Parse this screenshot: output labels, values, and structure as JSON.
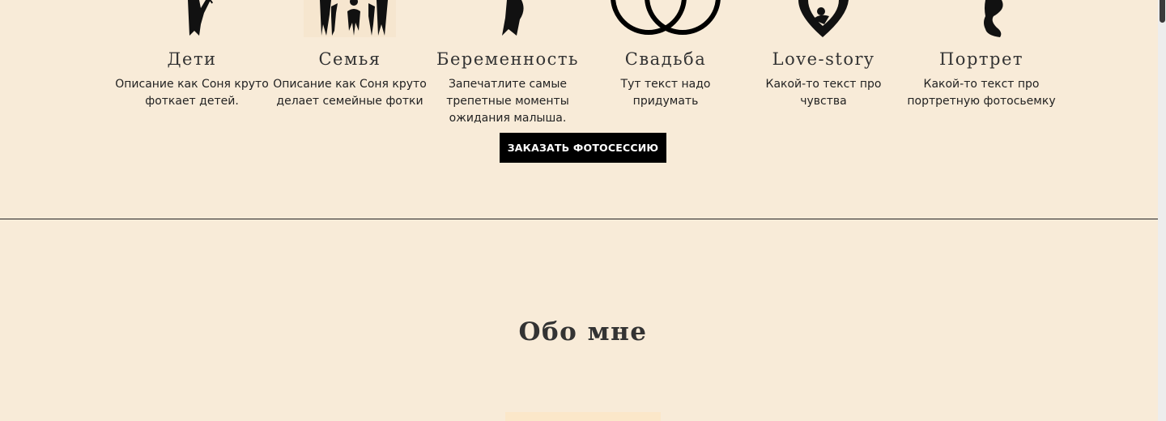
{
  "services": [
    {
      "icon": "child-silhouette-icon",
      "title": "Дети",
      "description": "Описание как Соня круто фоткает детей."
    },
    {
      "icon": "family-silhouette-icon",
      "title": "Семья",
      "description": "Описание как Соня круто делает семейные фотки"
    },
    {
      "icon": "pregnant-silhouette-icon",
      "title": "Беременность",
      "description": "Запечатлите самые трепетные моменты ожидания малыша."
    },
    {
      "icon": "wedding-rings-icon",
      "title": "Свадьба",
      "description": "Тут текст надо придумать"
    },
    {
      "icon": "heart-couple-icon",
      "title": "Love-story",
      "description": "Какой-то текст про чувства"
    },
    {
      "icon": "woman-profile-icon",
      "title": "Портрет",
      "description": "Какой-то текст про портретную фотосьемку"
    }
  ],
  "cta": {
    "label": "ЗАКАЗАТЬ ФОТОСЕССИЮ"
  },
  "about": {
    "title": "Обо мне"
  },
  "colors": {
    "background": "#f8ebd8",
    "button": "#000000",
    "button_text": "#ffffff",
    "heading": "#333333"
  }
}
